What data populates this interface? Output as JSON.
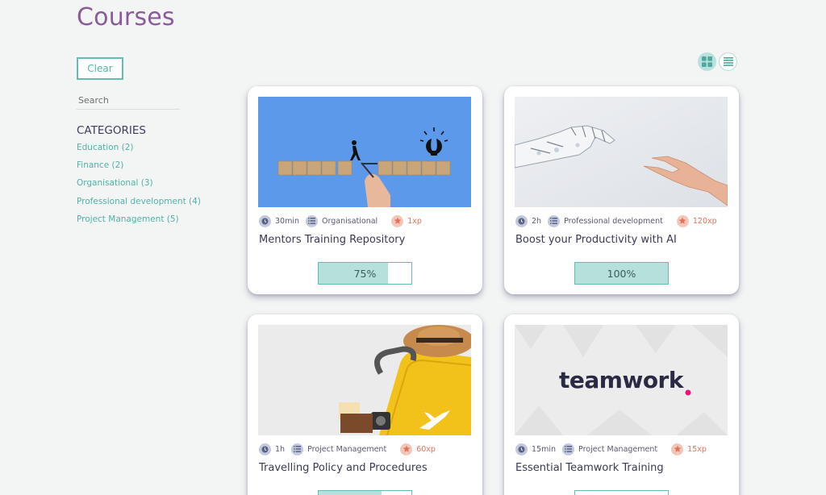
{
  "page": {
    "title": "Courses"
  },
  "sidebar": {
    "clear_label": "Clear",
    "search_placeholder": "Search",
    "categories_title": "CATEGORIES",
    "categories": [
      {
        "label": "Education  (2)"
      },
      {
        "label": "Finance  (2)"
      },
      {
        "label": "Organisational  (3)"
      },
      {
        "label": "Professional development  (4)"
      },
      {
        "label": "Project Management  (5)"
      }
    ]
  },
  "view_toggle": {
    "grid_icon": "grid-icon",
    "list_icon": "list-icon",
    "accent": "#b8e0dc"
  },
  "courses": [
    {
      "duration": "30min",
      "category": "Organisational",
      "xp": "1xp",
      "title": "Mentors Training Repository",
      "progress_label": "75%",
      "progress": 0.75,
      "image": "blocks-bridge-lightbulb"
    },
    {
      "duration": "2h",
      "category": "Professional development",
      "xp": "120xp",
      "title": "Boost your Productivity with AI",
      "progress_label": "100%",
      "progress": 1.0,
      "image": "robot-and-human-hands"
    },
    {
      "duration": "1h",
      "category": "Project Management",
      "xp": "60xp",
      "title": "Travelling Policy and Procedures",
      "progress_label": "",
      "progress": 0.68,
      "image": "yellow-suitcase"
    },
    {
      "duration": "15min",
      "category": "Project Management",
      "xp": "15xp",
      "title": "Essential Teamwork Training",
      "progress_label": "",
      "progress": null,
      "image": "teamwork-logo",
      "logo_text": "teamwork"
    }
  ],
  "colors": {
    "accent": "#63bdb3",
    "progress_fill": "#b5e0db",
    "title": "#8a5a9a",
    "xp": "#e2745b"
  }
}
